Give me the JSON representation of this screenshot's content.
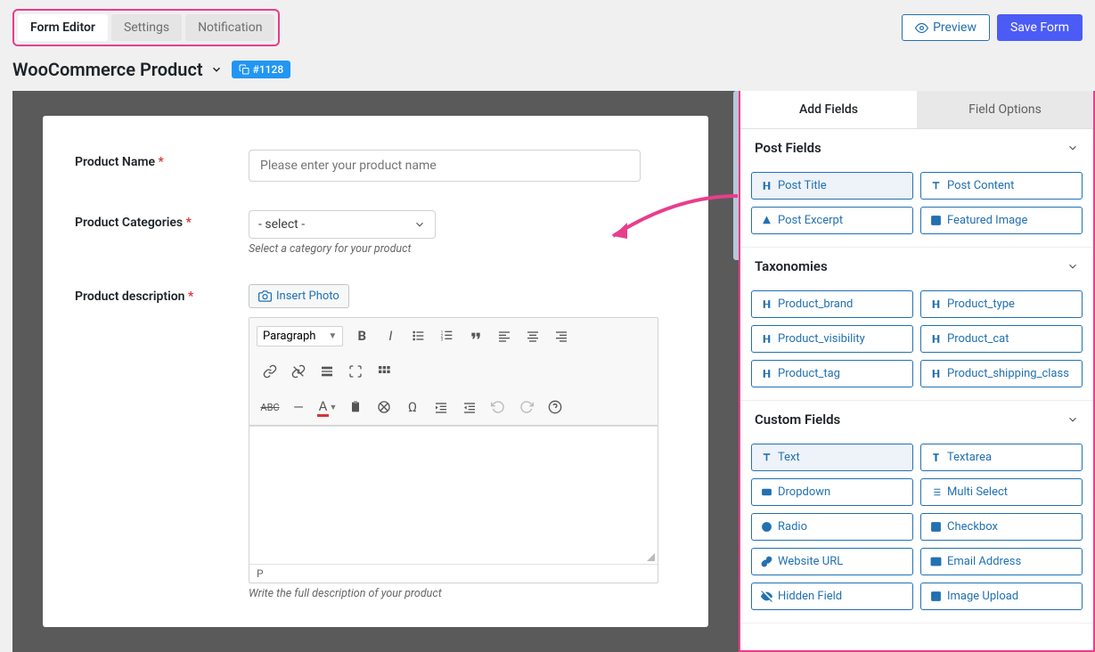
{
  "tabs": {
    "editor": "Form Editor",
    "settings": "Settings",
    "notification": "Notification"
  },
  "actions": {
    "preview": "Preview",
    "save": "Save Form"
  },
  "header": {
    "title": "WooCommerce Product",
    "badge_id": "#1128"
  },
  "form": {
    "name": {
      "label": "Product Name",
      "placeholder": "Please enter your product name"
    },
    "categories": {
      "label": "Product Categories",
      "selected": "- select -",
      "hint": "Select a category for your product"
    },
    "description": {
      "label": "Product description",
      "insert_photo": "Insert Photo",
      "format": "Paragraph",
      "status": "P",
      "hint": "Write the full description of your product"
    }
  },
  "sidebar": {
    "tab_add": "Add Fields",
    "tab_options": "Field Options",
    "sections": {
      "post_fields": {
        "title": "Post Fields",
        "items": [
          "Post Title",
          "Post Content",
          "Post Excerpt",
          "Featured Image"
        ]
      },
      "taxonomies": {
        "title": "Taxonomies",
        "items": [
          "Product_brand",
          "Product_type",
          "Product_visibility",
          "Product_cat",
          "Product_tag",
          "Product_shipping_class"
        ]
      },
      "custom_fields": {
        "title": "Custom Fields",
        "items": [
          "Text",
          "Textarea",
          "Dropdown",
          "Multi Select",
          "Radio",
          "Checkbox",
          "Website URL",
          "Email Address",
          "Hidden Field",
          "Image Upload"
        ]
      }
    }
  }
}
